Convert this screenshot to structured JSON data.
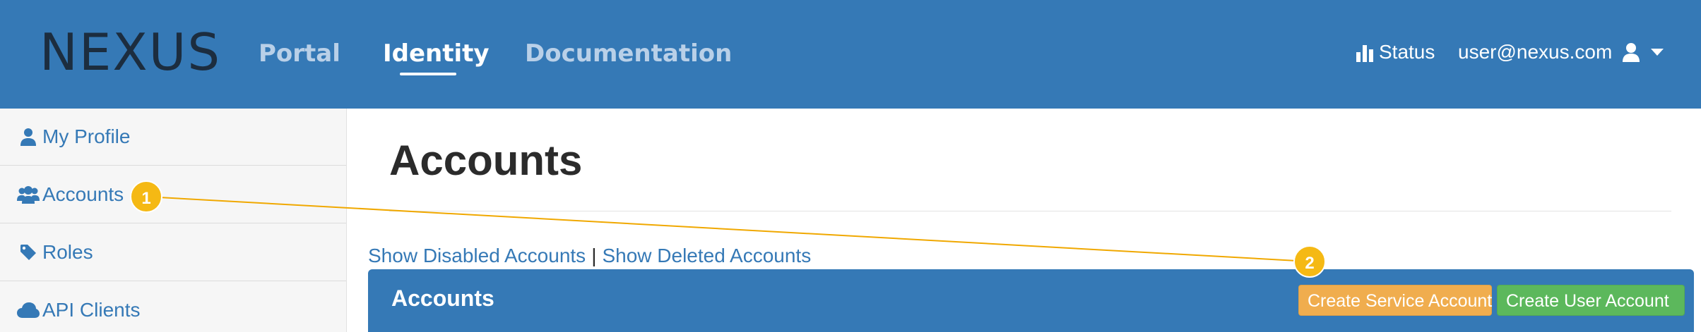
{
  "header": {
    "logo": "NEXUS",
    "nav": [
      {
        "label": "Portal",
        "active": false
      },
      {
        "label": "Identity",
        "active": true
      },
      {
        "label": "Documentation",
        "active": false
      }
    ],
    "status_label": "Status",
    "user_email": "user@nexus.com",
    "icons": {
      "status": "bar-chart-icon",
      "user": "user-icon",
      "caret": "caret-down-icon"
    }
  },
  "sidebar": {
    "items": [
      {
        "label": "My Profile",
        "icon": "user-icon"
      },
      {
        "label": "Accounts",
        "icon": "users-icon"
      },
      {
        "label": "Roles",
        "icon": "tag-icon"
      },
      {
        "label": "API Clients",
        "icon": "cloud-icon"
      }
    ]
  },
  "main": {
    "title": "Accounts",
    "filters": {
      "disabled_link": "Show Disabled Accounts",
      "separator": "|",
      "deleted_link": "Show Deleted Accounts"
    },
    "panel": {
      "title": "Accounts",
      "create_service_label": "Create Service Account",
      "create_user_label": "Create User Account"
    }
  },
  "annotations": {
    "markers": [
      {
        "label": "1",
        "target": "sidebar-item-accounts"
      },
      {
        "label": "2",
        "target": "create-service-account-button"
      }
    ],
    "color": "#f5b914"
  },
  "colors": {
    "primary": "#3579b6",
    "warning": "#f0ad4e",
    "success": "#5cb85c",
    "logo": "#1c2d3f"
  }
}
